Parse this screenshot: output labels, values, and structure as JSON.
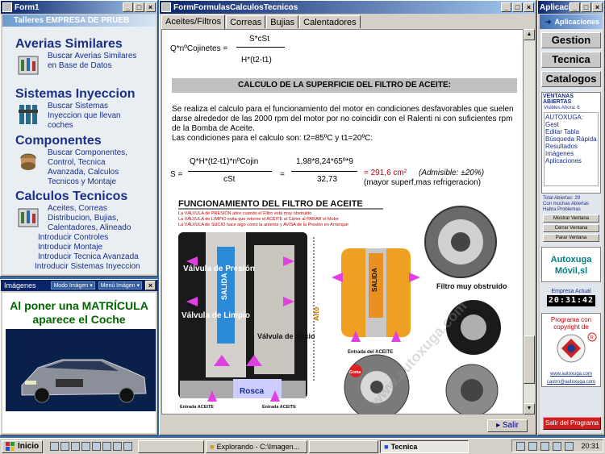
{
  "form1": {
    "title": "Form1",
    "header": "Talleres EMPRESA DE PRUEB",
    "sections": [
      {
        "title": "Averias Similares",
        "links": [
          "Buscar Averias Similares",
          "en Base de Datos"
        ]
      },
      {
        "title": "Sistemas Inyeccion",
        "links": [
          "Buscar Sistemas",
          "Inyeccion que llevan",
          "coches"
        ]
      },
      {
        "title": "Componentes",
        "links": [
          "Buscar Componentes,",
          "Control,  Tecnica",
          "Avanzada,  Calculos",
          "Tecnicos y Montaje"
        ]
      },
      {
        "title": "Calculos Tecnicos",
        "links": [
          "Aceites, Correas",
          "Distribucion,  Bujias,",
          "Calentadores, Alineado"
        ]
      }
    ],
    "extra_links": [
      "Introducir Controles",
      "Introducir Montaje",
      "Introducir Tecnica Avanzada",
      "Introducir Sistemas Inyeccion"
    ]
  },
  "imagenes": {
    "title": "Imágenes",
    "mode_select": "Modo Imágen",
    "menu_select": "Menú Imágen",
    "message": "Al poner una MATRÍCULA aparece el Coche"
  },
  "main": {
    "title": "FormFormulasCalculosTecnicos",
    "tabs": [
      "Aceites/Filtros",
      "Correas",
      "Bujias",
      "Calentadores"
    ],
    "formula1": {
      "lhs": "Q*nºCojinetes =",
      "num": "S*cSt",
      "den": "H*(t2-t1)"
    },
    "section_title": "CALCULO DE LA SUPERFICIE DEL FILTRO DE ACEITE:",
    "paragraph": "Se realiza el calculo para el funcionamiento del motor en condiciones desfavorables que suelen darse alrededor de las 2000 rpm del motor por no coincidir con el Ralenti   ni con suficientes rpm de la Bomba de Aceite.",
    "conditions": "Las condiciones para el calculo son:  t2=85ºC y t1=20ºC:",
    "formula2": {
      "lhs": "S =",
      "num1": "Q*H*(t2-t1)*nºCojin",
      "den1": "cSt",
      "eq": "=",
      "num2": "1,98*8,24*65º*9",
      "den2": "32,73",
      "result": "= 291,6 cm²",
      "admisible": "(Admisible:  ±20%)",
      "note": "(mayor superf,mas refrigeracion)"
    },
    "diagram": {
      "title": "FUNCIONAMIENTO DEL FILTRO DE ACEITE",
      "line1": "La VÁLVULA de PRESIÓN abre cuando el Filtro está muy obstruido",
      "line2": "La VÁLVULA de LIMPIO evita que retorne el ACEITE al Cárter al PARAR el Motor",
      "line3": "La VÁLVULA de SUCIO hace algo como la anterior y AVISA de la Presión en Arranque",
      "labels": {
        "presion": "Válvula de Presión",
        "limpio": "Válvula de Limpio",
        "sucio": "Válvula de Sucio",
        "salida": "SALIDA",
        "alto": "Alto",
        "rosca": "Rosca",
        "entrada1": "Entrada ACEITE",
        "entrada2": "Entrada ACEITE",
        "entrada3": "Entrada del ACEITE",
        "obstruido": "Filtro muy obstruido",
        "goma": "Goma"
      },
      "watermark": "www.autoxuga.com"
    },
    "exit_button": "Salir"
  },
  "apps": {
    "title": "Aplicacion",
    "header": "Aplicaciones",
    "buttons": [
      "Gestion",
      "Tecnica",
      "Catalogos"
    ],
    "open_title": "VENTANAS ABIERTAS",
    "visible_label": "Visibles Ahora: 6",
    "list": [
      "AUTOXUGA: Gest",
      "Editar Tabla",
      "Búsqueda Rápida",
      "Resultados",
      "Imágenes",
      "Aplicaciones"
    ],
    "total_label": "Total Abiertas: 29",
    "warn1": "Con muchas Abiertas",
    "warn2": "Habra Problemas",
    "small_buttons": [
      "Mostrar Ventana",
      "Cerrar Ventana",
      "Parar Ventana"
    ],
    "brand1": "Autoxuga",
    "brand2": "Móvil,sl",
    "company_label": "Empresa Actual",
    "clock": "20:31:42",
    "program_text": "Programa con copyright de",
    "link1": "www.autoxuga.com",
    "link2": "castro@autoxuga.com",
    "exit_program": "Salir del Programa"
  },
  "taskbar": {
    "start": "Inicio",
    "items": [
      "Explorando - C:\\Imagen...",
      "Tecnica"
    ],
    "time": "20:31"
  }
}
